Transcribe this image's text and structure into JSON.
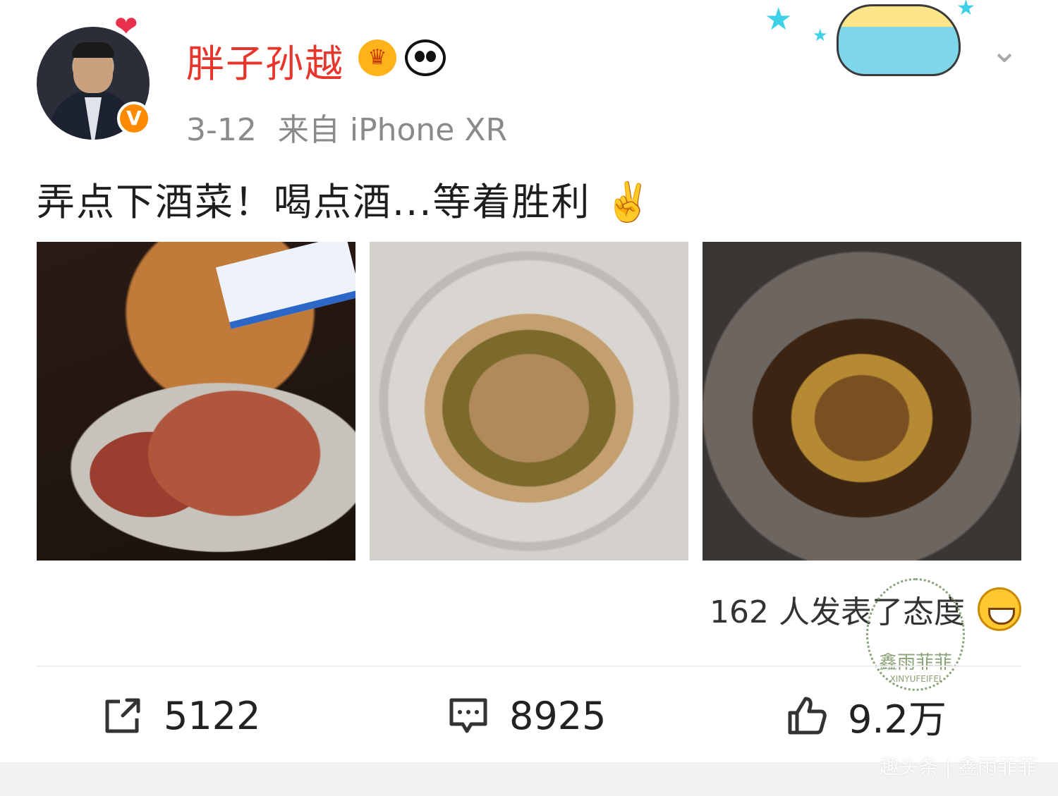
{
  "post": {
    "username": "胖子孙越",
    "date": "3-12",
    "source": "来自 iPhone XR",
    "text": "弄点下酒菜！喝点酒...等着胜利",
    "text_emoji": "✌️",
    "reactions_text": "162 人发表了态度",
    "share_count": "5122",
    "comment_count": "8925",
    "like_count": "9.2万"
  },
  "photos": [
    {
      "name": "beef-photo"
    },
    {
      "name": "enoki-cucumber-photo"
    },
    {
      "name": "braised-pork-bamboo-photo"
    }
  ],
  "watermark": {
    "main": "鑫雨菲菲",
    "sub": "XINYUFEIFEI",
    "footer": "趣头条 | 鑫雨菲菲"
  },
  "icons": {
    "verified": "V",
    "chevron": "chevron-down-icon",
    "share": "share-icon",
    "comment": "comment-icon",
    "like": "thumbs-up-icon"
  },
  "colors": {
    "username": "#e7352b",
    "meta": "#8a8a8a",
    "badge": "#ff8a00"
  }
}
